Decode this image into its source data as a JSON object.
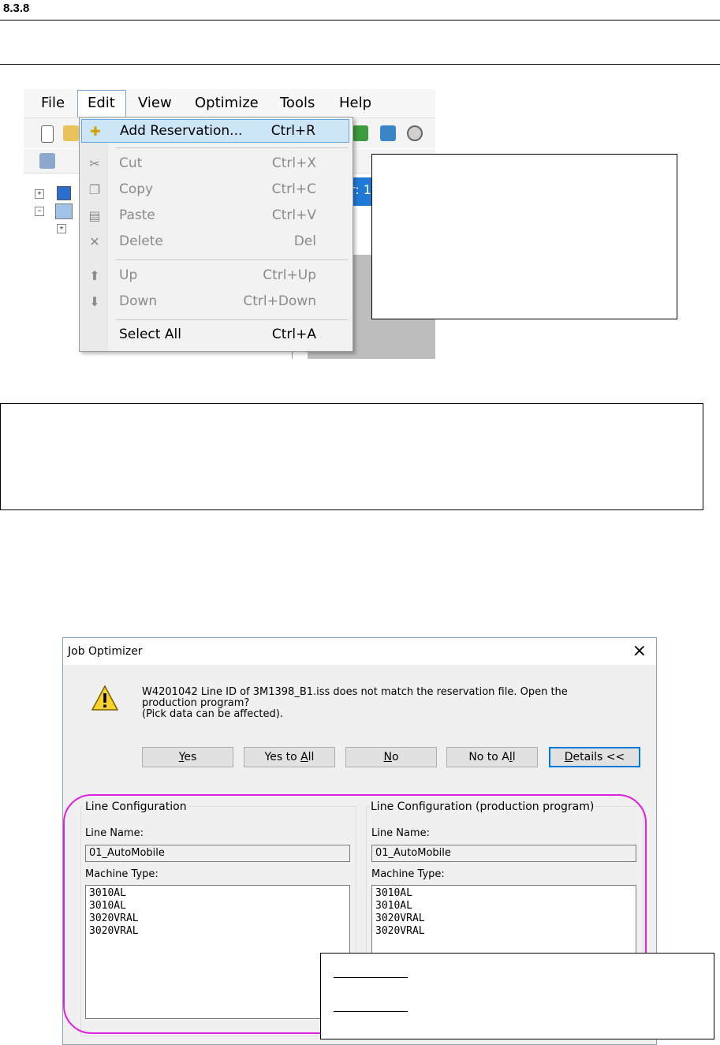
{
  "section_number": "8.3.8",
  "menu_screenshot": {
    "menubar": [
      "File",
      "Edit",
      "View",
      "Optimize",
      "Tools",
      "Help"
    ],
    "tab_fragment": "r: 1",
    "edit_menu": {
      "add_reservation": {
        "label": "Add Reservation...",
        "shortcut": "Ctrl+R"
      },
      "cut": {
        "label": "Cut",
        "shortcut": "Ctrl+X"
      },
      "copy": {
        "label": "Copy",
        "shortcut": "Ctrl+C"
      },
      "paste": {
        "label": "Paste",
        "shortcut": "Ctrl+V"
      },
      "delete": {
        "label": "Delete",
        "shortcut": "Del"
      },
      "up": {
        "label": "Up",
        "shortcut": "Ctrl+Up"
      },
      "down": {
        "label": "Down",
        "shortcut": "Ctrl+Down"
      },
      "select_all": {
        "label": "Select All",
        "shortcut": "Ctrl+A"
      }
    }
  },
  "dialog": {
    "title": "Job Optimizer",
    "close": "×",
    "message_line1": "W4201042 Line ID of 3M1398_B1.iss does not match the reservation file. Open the",
    "message_line2": "production program?",
    "message_line3": "(Pick data can be affected).",
    "buttons": {
      "yes_u": "Y",
      "yes_rest": "es",
      "yes_all_a": "Yes to ",
      "yes_all_u": "A",
      "yes_all_b": "ll",
      "no_u": "N",
      "no_rest": "o",
      "no_all_a": "No to A",
      "no_all_u": "l",
      "no_all_b": "l",
      "details_u": "D",
      "details_rest": "etails  <<"
    },
    "left_group": {
      "title": "Line Configuration",
      "line_name_label": "Line Name:",
      "line_name": "01_AutoMobile",
      "machine_type_label": "Machine Type:",
      "machines": [
        "3010AL",
        "3010AL",
        "3020VRAL",
        "3020VRAL"
      ]
    },
    "right_group": {
      "title": "Line Configuration (production program)",
      "line_name_label": "Line Name:",
      "line_name": "01_AutoMobile",
      "machine_type_label": "Machine Type:",
      "machines": [
        "3010AL",
        "3010AL",
        "3020VRAL",
        "3020VRAL"
      ]
    }
  }
}
